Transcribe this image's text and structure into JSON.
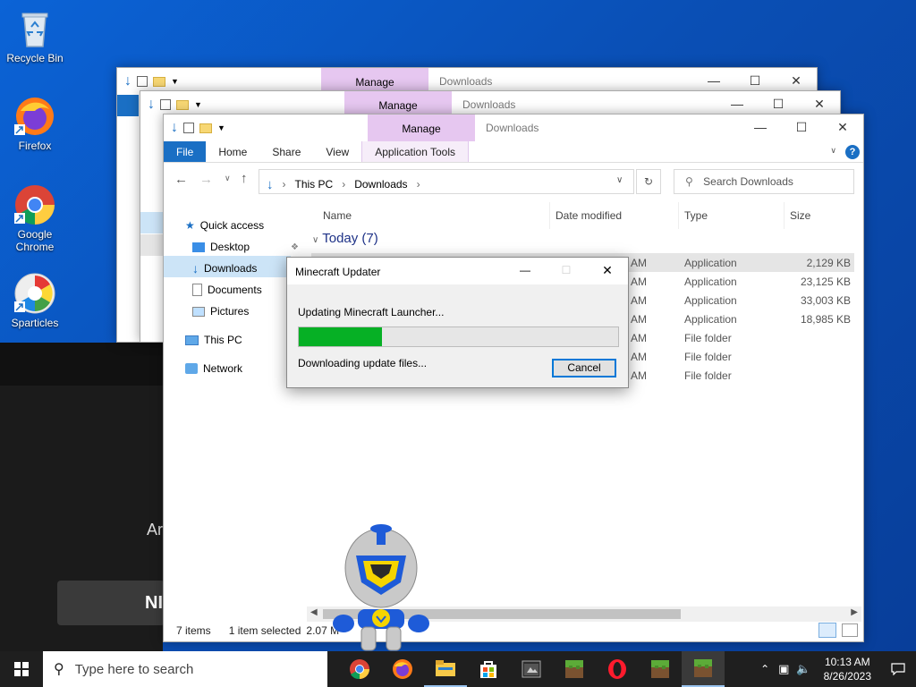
{
  "desktop": {
    "icons": [
      {
        "label": "Recycle Bin"
      },
      {
        "label": "Firefox"
      },
      {
        "label": "Google Chrome"
      },
      {
        "label": "Sparticles"
      }
    ],
    "promo_text": "Ar",
    "promo_button": "NI"
  },
  "back_windows": [
    {
      "manage_tab": "Manage",
      "title": "Downloads"
    },
    {
      "manage_tab": "Manage",
      "title": "Downloads"
    }
  ],
  "explorer": {
    "manage_tab": "Manage",
    "title": "Downloads",
    "ribbon_tabs": [
      "File",
      "Home",
      "Share",
      "View",
      "Application Tools"
    ],
    "breadcrumb": [
      "This PC",
      "Downloads"
    ],
    "search_placeholder": "Search Downloads",
    "nav": {
      "quick_access": "Quick access",
      "desktop": "Desktop",
      "downloads": "Downloads",
      "documents": "Documents",
      "pictures": "Pictures",
      "this_pc": "This PC",
      "network": "Network"
    },
    "columns": [
      "Name",
      "Date modified",
      "Type",
      "Size"
    ],
    "group_label": "Today (7)",
    "rows": [
      {
        "time": "AM",
        "type": "Application",
        "size": "2,129 KB"
      },
      {
        "time": "AM",
        "type": "Application",
        "size": "23,125 KB"
      },
      {
        "time": "AM",
        "type": "Application",
        "size": "33,003 KB"
      },
      {
        "time": "AM",
        "type": "Application",
        "size": "18,985 KB"
      },
      {
        "time": "AM",
        "type": "File folder",
        "size": ""
      },
      {
        "time": "AM",
        "type": "File folder",
        "size": ""
      },
      {
        "time": "AM",
        "type": "File folder",
        "size": ""
      }
    ],
    "status_items": "7 items",
    "status_selected": "1 item selected",
    "status_size": "2.07 M"
  },
  "dialog": {
    "title": "Minecraft Updater",
    "message": "Updating Minecraft Launcher...",
    "progress": 0.26,
    "status": "Downloading update files...",
    "cancel": "Cancel"
  },
  "taskbar": {
    "search_placeholder": "Type here to search",
    "time": "10:13 AM",
    "date": "8/26/2023"
  },
  "colors": {
    "file_tab": "#1a6fc4",
    "manage_tab": "#e6c7f0",
    "progress_fill": "#06b025",
    "selection": "#cce4f7"
  }
}
